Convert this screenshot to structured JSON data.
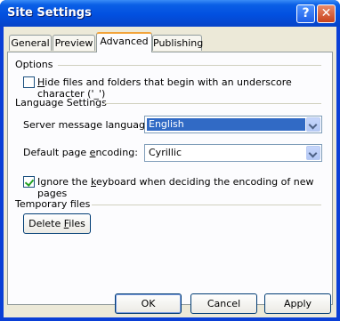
{
  "window": {
    "title": "Site Settings"
  },
  "titlebar": {
    "help_label": "?",
    "close_label": "✕"
  },
  "tabs": [
    {
      "label": "General"
    },
    {
      "label": "Preview"
    },
    {
      "label": "Advanced"
    },
    {
      "label": "Publishing"
    }
  ],
  "options": {
    "group_label": "Options",
    "hide_files_label_pre": "",
    "hide_files_label_u": "H",
    "hide_files_label_post": "ide files and folders that begin with an underscore character ('_')",
    "hide_files_checked": false
  },
  "language": {
    "group_label": "Language Settings",
    "server_lang_label": "Server message language:",
    "server_lang_value": "English",
    "encoding_label_pre": "Default page ",
    "encoding_label_u": "e",
    "encoding_label_post": "ncoding:",
    "encoding_value": "Cyrillic",
    "ignore_kb_label_pre": "Ignore the ",
    "ignore_kb_label_u": "k",
    "ignore_kb_label_post": "eyboard when deciding the encoding of new pages",
    "ignore_kb_checked": true
  },
  "temp": {
    "group_label": "Temporary files",
    "delete_pre": "Delete ",
    "delete_u": "F",
    "delete_post": "iles"
  },
  "footer": {
    "ok": "OK",
    "cancel": "Cancel",
    "apply": "Apply"
  }
}
